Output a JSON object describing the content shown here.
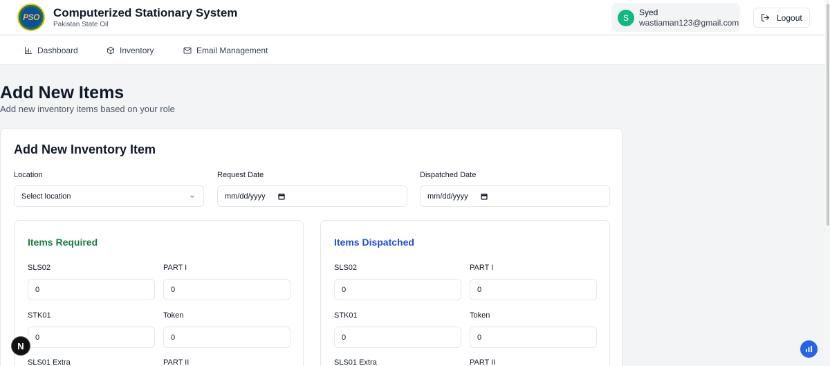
{
  "header": {
    "logo_text": "PSO",
    "title": "Computerized Stationary System",
    "subtitle": "Pakistan State Oil",
    "user": {
      "initial": "S",
      "name": "Syed",
      "email": "wastiaman123@gmail.com"
    },
    "logout_label": "Logout"
  },
  "nav": {
    "items": [
      {
        "label": "Dashboard",
        "icon": "bar-chart-icon"
      },
      {
        "label": "Inventory",
        "icon": "package-icon"
      },
      {
        "label": "Email Management",
        "icon": "mail-icon"
      }
    ]
  },
  "page": {
    "title": "Add New Items",
    "subtitle": "Add new inventory items based on your role"
  },
  "form": {
    "title": "Add New Inventory Item",
    "location": {
      "label": "Location",
      "value": "Select location"
    },
    "request_date": {
      "label": "Request Date",
      "placeholder": "mm/dd/yyyy"
    },
    "dispatched_date": {
      "label": "Dispatched Date",
      "placeholder": "mm/dd/yyyy"
    }
  },
  "items_required": {
    "title": "Items Required",
    "color": "#15803d",
    "fields": [
      {
        "label": "SLS02",
        "value": "0"
      },
      {
        "label": "PART I",
        "value": "0"
      },
      {
        "label": "STK01",
        "value": "0"
      },
      {
        "label": "Token",
        "value": "0"
      },
      {
        "label": "SLS01 Extra",
        "value": ""
      },
      {
        "label": "PART II",
        "value": ""
      }
    ]
  },
  "items_dispatched": {
    "title": "Items Dispatched",
    "color": "#1d4ed8",
    "fields": [
      {
        "label": "SLS02",
        "value": "0"
      },
      {
        "label": "PART I",
        "value": "0"
      },
      {
        "label": "STK01",
        "value": "0"
      },
      {
        "label": "Token",
        "value": "0"
      },
      {
        "label": "SLS01 Extra",
        "value": ""
      },
      {
        "label": "PART II",
        "value": ""
      }
    ]
  },
  "badges": {
    "n_label": "N"
  }
}
